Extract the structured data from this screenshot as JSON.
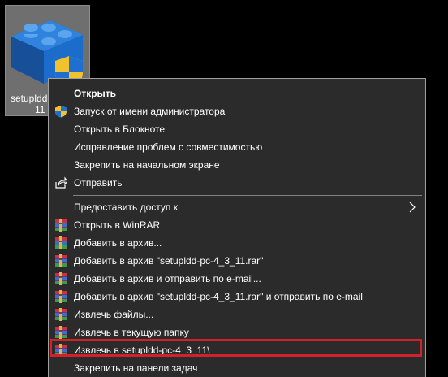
{
  "desktop_icon": {
    "label_line1": "setupldd",
    "label_line2": "11"
  },
  "menu": {
    "items": [
      {
        "label": "Открыть",
        "icon": "none"
      },
      {
        "label": "Запуск от имени администратора",
        "icon": "shield-icon"
      },
      {
        "label": "Открыть в Блокноте",
        "icon": "none"
      },
      {
        "label": "Исправление проблем с совместимостью",
        "icon": "none"
      },
      {
        "label": "Закрепить на начальном экране",
        "icon": "none"
      },
      {
        "label": "Отправить",
        "icon": "share-icon"
      },
      {
        "label": "Предоставить доступ к",
        "icon": "chevron-right-icon"
      },
      {
        "label": "Открыть в WinRAR",
        "icon": "winrar-icon"
      },
      {
        "label": "Добавить в архив...",
        "icon": "winrar-icon"
      },
      {
        "label": "Добавить в архив \"setupldd-pc-4_3_11.rar\"",
        "icon": "winrar-icon"
      },
      {
        "label": "Добавить в архив и отправить по e-mail...",
        "icon": "winrar-icon"
      },
      {
        "label": "Добавить в архив \"setupldd-pc-4_3_11.rar\" и отправить по e-mail",
        "icon": "winrar-icon"
      },
      {
        "label": "Извлечь файлы...",
        "icon": "winrar-icon"
      },
      {
        "label": "Извлечь в текущую папку",
        "icon": "winrar-icon"
      },
      {
        "label": "Извлечь в setupldd-pc-4_3_11\\",
        "icon": "winrar-icon"
      },
      {
        "label": "Закрепить на панели задач",
        "icon": "none"
      }
    ]
  },
  "colors": {
    "menu_bg": "#2b2b2b",
    "highlight_border": "#d2212b",
    "icon_bg": "#6f6f6f"
  }
}
